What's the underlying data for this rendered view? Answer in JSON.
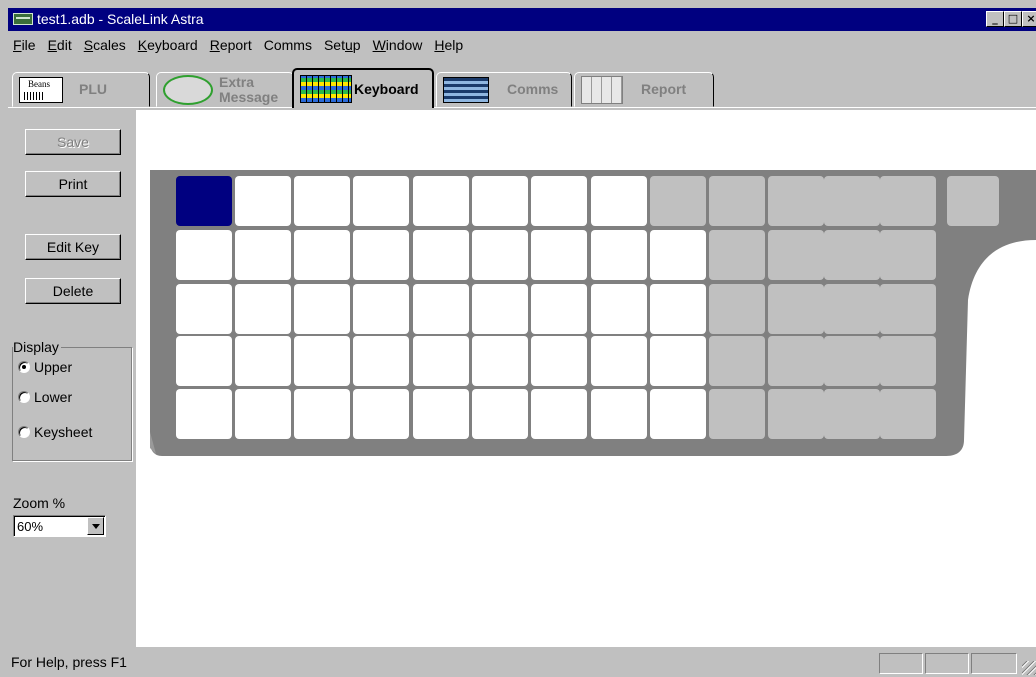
{
  "window": {
    "title": "test1.adb - ScaleLink Astra",
    "controls": [
      "_",
      "□",
      "×"
    ]
  },
  "menu": [
    {
      "pre": "",
      "u": "F",
      "post": "ile"
    },
    {
      "pre": "",
      "u": "E",
      "post": "dit"
    },
    {
      "pre": "",
      "u": "S",
      "post": "cales"
    },
    {
      "pre": "",
      "u": "K",
      "post": "eyboard"
    },
    {
      "pre": "",
      "u": "R",
      "post": "eport"
    },
    {
      "pre": "Comms",
      "u": "",
      "post": ""
    },
    {
      "pre": "Set",
      "u": "u",
      "post": "p"
    },
    {
      "pre": "",
      "u": "W",
      "post": "indow"
    },
    {
      "pre": "",
      "u": "H",
      "post": "elp"
    }
  ],
  "tabs": [
    {
      "label": "PLU",
      "icon": "plu-label-icon",
      "active": false
    },
    {
      "label": "Extra Message",
      "line1": "Extra",
      "line2": "Message",
      "icon": "extra-message-icon",
      "active": false
    },
    {
      "label": "Keyboard",
      "icon": "keyboard-icon",
      "active": true
    },
    {
      "label": "Comms",
      "icon": "comms-icon",
      "active": false
    },
    {
      "label": "Report",
      "icon": "report-icon",
      "active": false
    }
  ],
  "left_panel": {
    "save_label": "Save",
    "print_label": "Print",
    "edit_key_label": "Edit Key",
    "delete_label": "Delete",
    "display": {
      "legend": "Display",
      "options": [
        {
          "label": "Upper",
          "checked": true
        },
        {
          "label": "Lower",
          "checked": false
        },
        {
          "label": "Keysheet",
          "checked": false
        }
      ]
    },
    "zoom": {
      "label": "Zoom %",
      "value": "60%"
    }
  },
  "keyboard": {
    "selected_key": [
      0,
      0
    ],
    "colors": {
      "body": "#808080",
      "key_white": "#ffffff",
      "key_gray": "#c0c0c0",
      "key_selected": "#000080"
    }
  },
  "status": {
    "text": "For Help, press F1"
  }
}
